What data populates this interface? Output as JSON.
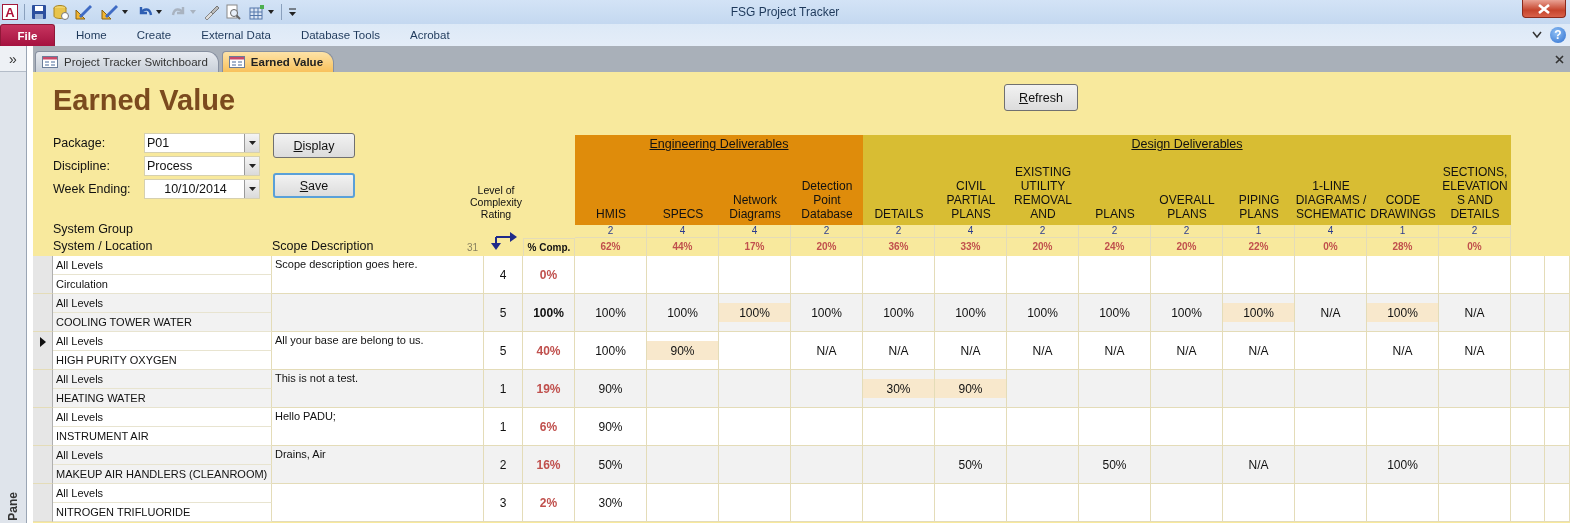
{
  "window": {
    "app_logo": "A",
    "title": "FSG Project Tracker"
  },
  "ribbon": {
    "file_tab": "File",
    "tabs": [
      "Home",
      "Create",
      "External Data",
      "Database Tools",
      "Acrobat"
    ],
    "help_button": "?"
  },
  "nav_pane": {
    "expand_button": "»",
    "label": "Pane"
  },
  "document_tabs": [
    {
      "label": "Project Tracker Switchboard",
      "selected": false
    },
    {
      "label": "Earned Value",
      "selected": true
    }
  ],
  "form": {
    "title": "Earned Value",
    "refresh_button": "Refresh",
    "filters": [
      {
        "label": "Package:",
        "value": "P01"
      },
      {
        "label": "Discipline:",
        "value": "Process"
      },
      {
        "label": "Week Ending:",
        "value": "10/10/2014"
      }
    ],
    "buttons": [
      {
        "label": "Display",
        "focused": false
      },
      {
        "label": "Save",
        "focused": true
      }
    ],
    "complexity_label": "Level of Complexity Rating",
    "system_group_label": "System Group",
    "system_location_label": "System / Location",
    "scope_label": "Scope Description",
    "record_count": "31",
    "percent_label": "% Comp.",
    "groups": [
      {
        "title": "Engineering Deliverables",
        "color": "#df8c0b",
        "columns": [
          {
            "title": "HMIS",
            "weight": "2",
            "percent": "62%"
          },
          {
            "title": "SPECS",
            "weight": "4",
            "percent": "44%"
          },
          {
            "title": "Network Diagrams",
            "weight": "4",
            "percent": "17%"
          },
          {
            "title": "Detection Point Database",
            "weight": "2",
            "percent": "20%"
          }
        ]
      },
      {
        "title": "Design Deliverables",
        "color": "#d8bd33",
        "columns": [
          {
            "title": "DETAILS",
            "weight": "2",
            "percent": "36%"
          },
          {
            "title": "CIVIL PARTIAL PLANS",
            "weight": "4",
            "percent": "33%"
          },
          {
            "title": "EXISTING UTILITY REMOVAL AND",
            "weight": "2",
            "percent": "20%"
          },
          {
            "title": "PLANS",
            "weight": "2",
            "percent": "24%"
          },
          {
            "title": "OVERALL PLANS",
            "weight": "2",
            "percent": "20%"
          },
          {
            "title": "PIPING PLANS",
            "weight": "1",
            "percent": "22%"
          },
          {
            "title": "1-LINE DIAGRAMS / SCHEMATIC",
            "weight": "4",
            "percent": "0%"
          },
          {
            "title": "CODE DRAWINGS",
            "weight": "1",
            "percent": "28%"
          },
          {
            "title": "SECTIONS, ELEVATIONS AND DETAILS",
            "weight": "2",
            "percent": "0%"
          }
        ]
      }
    ],
    "rows": [
      {
        "current": false,
        "system_group": "All Levels",
        "system": "Circulation",
        "scope": "Scope description goes here.",
        "rating": "4",
        "percent": "0%",
        "complete": false,
        "cells": [
          {
            "highlighted": false
          },
          {
            "highlighted": false
          },
          {
            "highlighted": false
          },
          {
            "highlighted": false
          },
          {
            "highlighted": false
          },
          {
            "highlighted": false
          },
          {
            "highlighted": false
          },
          {
            "highlighted": false
          },
          {
            "highlighted": false
          },
          {
            "highlighted": false
          },
          {
            "highlighted": false
          },
          {
            "highlighted": false
          },
          {
            "highlighted": false
          }
        ]
      },
      {
        "current": false,
        "system_group": "All Levels",
        "system": "COOLING TOWER WATER",
        "rating": "5",
        "percent": "100%",
        "complete": true,
        "cells": [
          {
            "value": "100%",
            "highlighted": false
          },
          {
            "value": "100%",
            "highlighted": false
          },
          {
            "value": "100%",
            "highlighted": true
          },
          {
            "value": "100%",
            "highlighted": false
          },
          {
            "value": "100%",
            "highlighted": false
          },
          {
            "value": "100%",
            "highlighted": false
          },
          {
            "value": "100%",
            "highlighted": false
          },
          {
            "value": "100%",
            "highlighted": false
          },
          {
            "value": "100%",
            "highlighted": false
          },
          {
            "value": "100%",
            "highlighted": true
          },
          {
            "value": "N/A",
            "highlighted": false
          },
          {
            "value": "100%",
            "highlighted": true
          },
          {
            "value": "N/A",
            "highlighted": false
          }
        ]
      },
      {
        "current": true,
        "system_group": "All Levels",
        "system": "HIGH PURITY OXYGEN",
        "scope": "All your base are belong to us.",
        "rating": "5",
        "percent": "40%",
        "complete": false,
        "cells": [
          {
            "value": "100%",
            "highlighted": false
          },
          {
            "value": "90%",
            "highlighted": true
          },
          {
            "highlighted": false
          },
          {
            "value": "N/A",
            "highlighted": false
          },
          {
            "value": "N/A",
            "highlighted": false
          },
          {
            "value": "N/A",
            "highlighted": false
          },
          {
            "value": "N/A",
            "highlighted": false
          },
          {
            "value": "N/A",
            "highlighted": false
          },
          {
            "value": "N/A",
            "highlighted": false
          },
          {
            "value": "N/A",
            "highlighted": false
          },
          {
            "highlighted": false
          },
          {
            "value": "N/A",
            "highlighted": false
          },
          {
            "value": "N/A",
            "highlighted": false
          }
        ]
      },
      {
        "current": false,
        "system_group": "All Levels",
        "system": "HEATING WATER",
        "scope": "This is not a test.",
        "rating": "1",
        "percent": "19%",
        "complete": false,
        "cells": [
          {
            "value": "90%",
            "highlighted": false
          },
          {
            "highlighted": false
          },
          {
            "highlighted": false
          },
          {
            "highlighted": false
          },
          {
            "value": "30%",
            "highlighted": true
          },
          {
            "value": "90%",
            "highlighted": true
          },
          {
            "highlighted": false
          },
          {
            "highlighted": false
          },
          {
            "highlighted": false
          },
          {
            "highlighted": false
          },
          {
            "highlighted": false
          },
          {
            "highlighted": false
          },
          {
            "highlighted": false
          }
        ]
      },
      {
        "current": false,
        "system_group": "All Levels",
        "system": "INSTRUMENT AIR",
        "scope": "Hello PADU;",
        "rating": "1",
        "percent": "6%",
        "complete": false,
        "cells": [
          {
            "value": "90%",
            "highlighted": false
          },
          {
            "highlighted": false
          },
          {
            "highlighted": false
          },
          {
            "highlighted": false
          },
          {
            "highlighted": false
          },
          {
            "highlighted": false
          },
          {
            "highlighted": false
          },
          {
            "highlighted": false
          },
          {
            "highlighted": false
          },
          {
            "highlighted": false
          },
          {
            "highlighted": false
          },
          {
            "highlighted": false
          },
          {
            "highlighted": false
          }
        ]
      },
      {
        "current": false,
        "system_group": "All Levels",
        "system": "MAKEUP AIR HANDLERS (CLEANROOM)",
        "scope": "Drains, Air",
        "rating": "2",
        "percent": "16%",
        "complete": false,
        "cells": [
          {
            "value": "50%",
            "highlighted": false
          },
          {
            "highlighted": false
          },
          {
            "highlighted": false
          },
          {
            "highlighted": false
          },
          {
            "highlighted": false
          },
          {
            "value": "50%",
            "highlighted": false
          },
          {
            "highlighted": false
          },
          {
            "value": "50%",
            "highlighted": false
          },
          {
            "highlighted": false
          },
          {
            "value": "N/A",
            "highlighted": false
          },
          {
            "highlighted": false
          },
          {
            "value": "100%",
            "highlighted": false
          },
          {
            "highlighted": false
          }
        ]
      },
      {
        "current": false,
        "system_group": "All Levels",
        "system": "NITROGEN TRIFLUORIDE",
        "rating": "3",
        "percent": "2%",
        "complete": false,
        "cells": [
          {
            "value": "30%",
            "highlighted": false
          },
          {
            "highlighted": false
          },
          {
            "highlighted": false
          },
          {
            "highlighted": false
          },
          {
            "highlighted": false
          },
          {
            "highlighted": false
          },
          {
            "highlighted": false
          },
          {
            "highlighted": false
          },
          {
            "highlighted": false
          },
          {
            "highlighted": false
          },
          {
            "highlighted": false
          },
          {
            "highlighted": false
          },
          {
            "highlighted": false
          }
        ]
      }
    ]
  }
}
